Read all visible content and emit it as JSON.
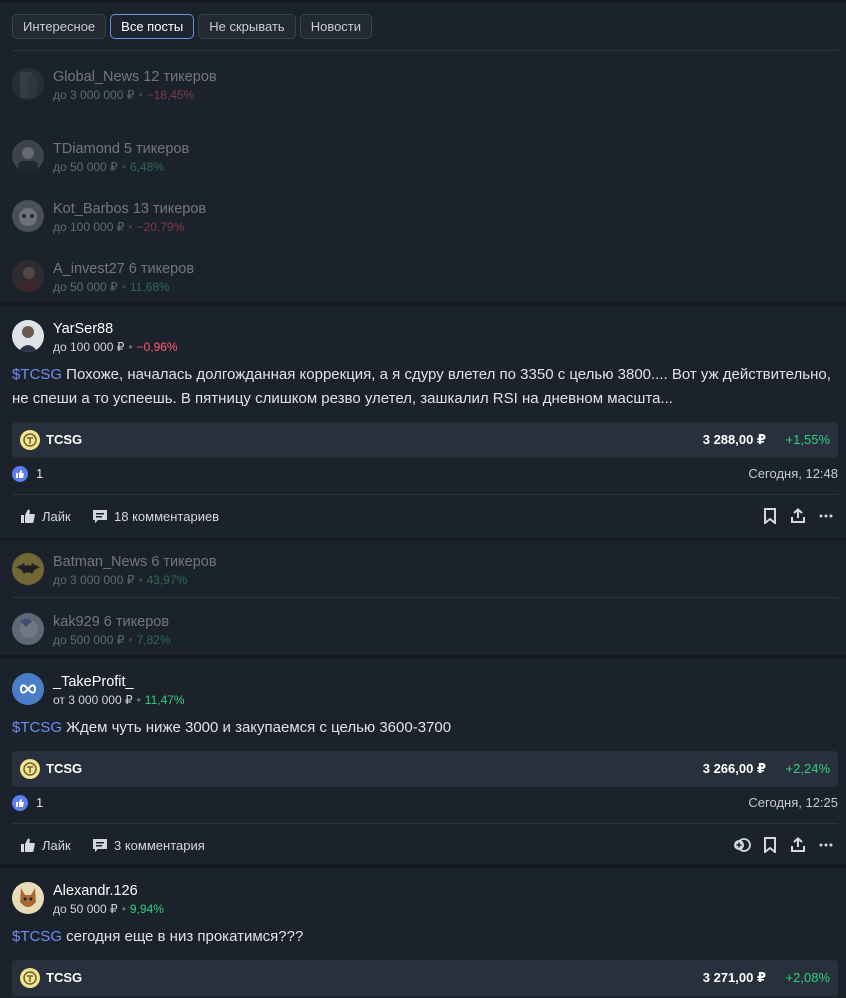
{
  "filters": [
    "Интересное",
    "Все посты",
    "Не скрывать",
    "Новости"
  ],
  "collapsed_authors": [
    {
      "name": "Global_News",
      "tickers": "12 тикеров",
      "capital": "до 3 000 000 ₽",
      "yield": "−18,45%",
      "sign": "neg"
    },
    {
      "name": "TDiamond",
      "tickers": "5 тикеров",
      "capital": "до 50 000 ₽",
      "yield": "6,48%",
      "sign": "pos"
    },
    {
      "name": "Kot_Barbos",
      "tickers": "13 тикеров",
      "capital": "до 100 000 ₽",
      "yield": "−20,79%",
      "sign": "neg"
    },
    {
      "name": "A_invest27",
      "tickers": "6 тикеров",
      "capital": "до 50 000 ₽",
      "yield": "11,68%",
      "sign": "pos"
    },
    {
      "name": "Batman_News",
      "tickers": "6 тикеров",
      "capital": "до 3 000 000 ₽",
      "yield": "43,97%",
      "sign": "pos"
    },
    {
      "name": "kak929",
      "tickers": "6 тикеров",
      "capital": "до 500 000 ₽",
      "yield": "7,82%",
      "sign": "pos"
    }
  ],
  "posts": [
    {
      "author": "YarSer88",
      "capital": "до 100 000 ₽",
      "yield": "−0,96%",
      "tag": "$TCSG",
      "text": " Похоже, началась долгожданная коррекция, а я сдуру влетел по 3350 с целью 3800.... Вот уж действительно, не спеши а то успеешь. В пятницу слишком резво улетел, зашкалил RSI на дневном масшта...",
      "ticker": {
        "name": "TCSG",
        "price": "3 288,00 ₽",
        "change": "+1,55%"
      },
      "likes": "1",
      "time": "Сегодня, 12:48",
      "like_label": "Лайк",
      "comments": "18 комментариев"
    },
    {
      "author": "_TakeProfit_",
      "capital": "от 3 000 000 ₽",
      "yield": "11,47%",
      "tag": "$TCSG",
      "text": " Ждем чуть ниже 3000 и закупаемся с целью 3600-3700",
      "ticker": {
        "name": "TCSG",
        "price": "3 266,00 ₽",
        "change": "+2,24%"
      },
      "likes": "1",
      "time": "Сегодня, 12:25",
      "like_label": "Лайк",
      "comments": "3 комментария"
    },
    {
      "author": "Alexandr.126",
      "capital": "до 50 000 ₽",
      "yield": "9,94%",
      "tag": "$TCSG",
      "text": " сегодня еще в низ прокатимся???",
      "ticker": {
        "name": "TCSG",
        "price": "3 271,00 ₽",
        "change": "+2,08%"
      }
    }
  ],
  "icons": {
    "like": "thumb-up-icon",
    "comment": "comment-icon",
    "bookmark": "bookmark-icon",
    "share": "share-icon",
    "more": "more-icon",
    "donate": "donate-icon",
    "ticker_logo": "tcs-logo-icon"
  },
  "colors": {
    "accent": "#6b8fe8",
    "negative": "#ff5b6b",
    "positive": "#2fd17c",
    "background": "#1c222c"
  }
}
